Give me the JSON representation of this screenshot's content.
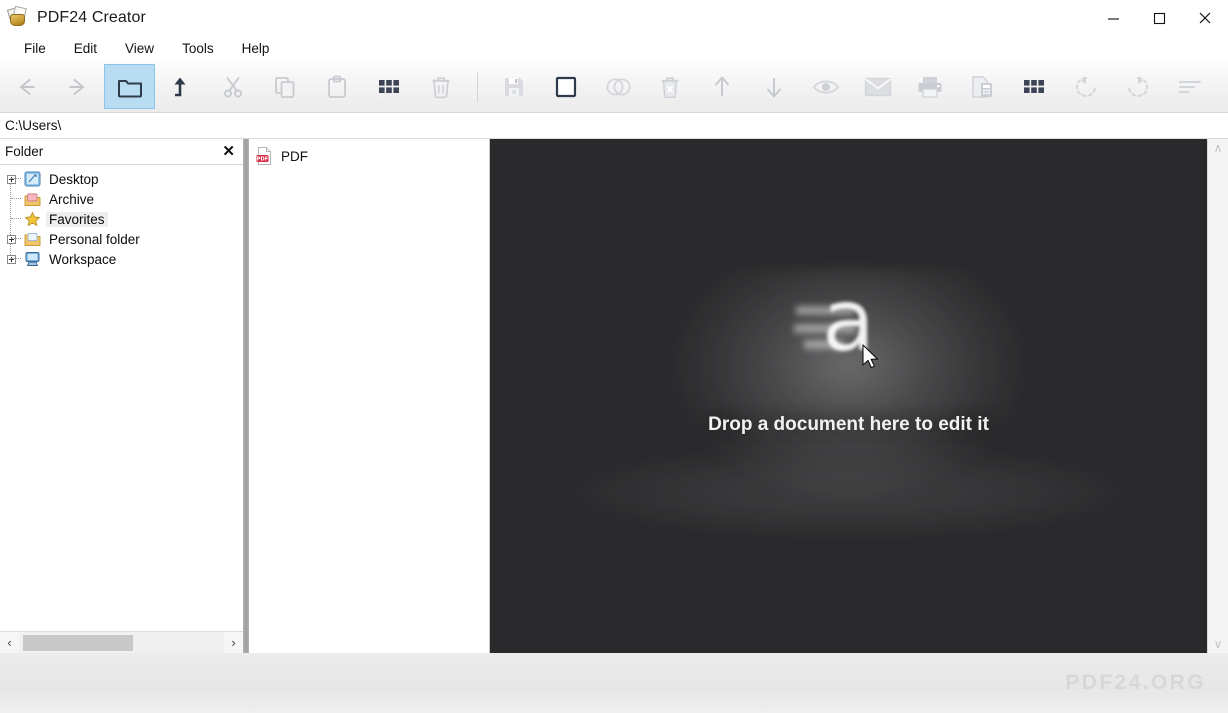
{
  "window": {
    "title": "PDF24 Creator",
    "app_icon": "pdf24-bag-icon",
    "controls": {
      "minimize": "minimize-icon",
      "maximize": "maximize-icon",
      "close": "close-icon"
    }
  },
  "menubar": {
    "items": [
      {
        "label": "File"
      },
      {
        "label": "Edit"
      },
      {
        "label": "View"
      },
      {
        "label": "Tools"
      },
      {
        "label": "Help"
      }
    ]
  },
  "toolbar": {
    "group_left": [
      {
        "name": "back-icon",
        "title": "Back",
        "active": false
      },
      {
        "name": "forward-icon",
        "title": "Forward",
        "active": false
      },
      {
        "name": "folder-icon",
        "title": "Folder",
        "active": true
      },
      {
        "name": "up-icon",
        "title": "Up one level",
        "active": false
      },
      {
        "name": "cut-icon",
        "title": "Cut",
        "active": false
      },
      {
        "name": "copy-icon",
        "title": "Copy",
        "active": false
      },
      {
        "name": "paste-icon",
        "title": "Paste",
        "active": false
      },
      {
        "name": "grid-icon",
        "title": "Select all",
        "active": false
      },
      {
        "name": "trash-icon",
        "title": "Delete",
        "active": false
      }
    ],
    "group_right": [
      {
        "name": "save-icon",
        "title": "Save"
      },
      {
        "name": "select-page-icon",
        "title": "Select page"
      },
      {
        "name": "merge-icon",
        "title": "Merge"
      },
      {
        "name": "delete-page-icon",
        "title": "Delete page"
      },
      {
        "name": "move-up-icon",
        "title": "Move up"
      },
      {
        "name": "move-down-icon",
        "title": "Move down"
      },
      {
        "name": "preview-eye-icon",
        "title": "Preview"
      },
      {
        "name": "mail-icon",
        "title": "Send by e-mail"
      },
      {
        "name": "print-icon",
        "title": "Print"
      },
      {
        "name": "fax-icon",
        "title": "Fax"
      },
      {
        "name": "grid-view-icon",
        "title": "Grid view"
      },
      {
        "name": "rotate-left-icon",
        "title": "Rotate left"
      },
      {
        "name": "rotate-right-icon",
        "title": "Rotate right"
      },
      {
        "name": "sort-icon",
        "title": "Sort"
      }
    ]
  },
  "address": {
    "path": "C:\\Users\\"
  },
  "tree_panel": {
    "header": "Folder",
    "close_label": "✕",
    "items": [
      {
        "label": "Desktop",
        "icon": "desktop-icon",
        "expandable": true,
        "selected": false
      },
      {
        "label": "Archive",
        "icon": "archive-icon",
        "expandable": false,
        "selected": false
      },
      {
        "label": "Favorites",
        "icon": "star-icon",
        "expandable": false,
        "selected": true
      },
      {
        "label": "Personal folder",
        "icon": "folder-icon",
        "expandable": true,
        "selected": false
      },
      {
        "label": "Workspace",
        "icon": "computer-icon",
        "expandable": true,
        "selected": false
      }
    ],
    "hscroll": {
      "left_arrow": "‹",
      "right_arrow": "›"
    }
  },
  "file_list": {
    "items": [
      {
        "label": "PDF",
        "icon": "pdf-file-icon"
      }
    ]
  },
  "preview": {
    "drop_text": "Drop a document here to edit it",
    "glyph": "a",
    "cursor": "mouse-pointer"
  },
  "vscroll": {
    "up_arrow": "∧",
    "down_arrow": "∨"
  },
  "footer": {
    "watermark": "PDF24.ORG"
  },
  "colors": {
    "accent_active": "#b8dcf2",
    "preview_bg": "#2a2a2c",
    "pdf_badge": "#d32b45",
    "watermark": "#d7d7d7"
  }
}
